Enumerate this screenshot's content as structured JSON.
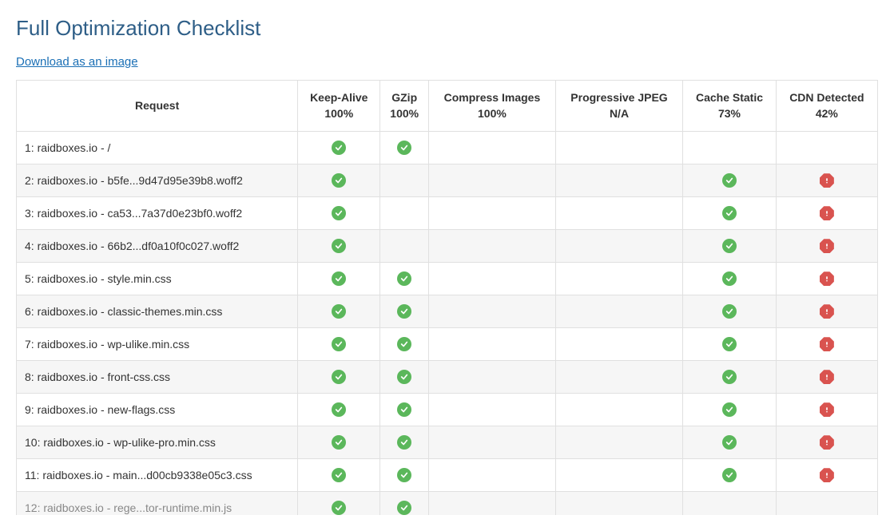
{
  "title": "Full Optimization Checklist",
  "download_link": "Download as an image",
  "columns": [
    {
      "label": "Request",
      "sub": ""
    },
    {
      "label": "Keep-Alive",
      "sub": "100%"
    },
    {
      "label": "GZip",
      "sub": "100%"
    },
    {
      "label": "Compress Images",
      "sub": "100%"
    },
    {
      "label": "Progressive JPEG",
      "sub": "N/A"
    },
    {
      "label": "Cache Static",
      "sub": "73%"
    },
    {
      "label": "CDN Detected",
      "sub": "42%"
    }
  ],
  "rows": [
    {
      "request": "1: raidboxes.io - /",
      "keep_alive": "check",
      "gzip": "check",
      "compress": "",
      "pjpeg": "",
      "cache": "",
      "cdn": ""
    },
    {
      "request": "2: raidboxes.io - b5fe...9d47d95e39b8.woff2",
      "keep_alive": "check",
      "gzip": "",
      "compress": "",
      "pjpeg": "",
      "cache": "check",
      "cdn": "warn"
    },
    {
      "request": "3: raidboxes.io - ca53...7a37d0e23bf0.woff2",
      "keep_alive": "check",
      "gzip": "",
      "compress": "",
      "pjpeg": "",
      "cache": "check",
      "cdn": "warn"
    },
    {
      "request": "4: raidboxes.io - 66b2...df0a10f0c027.woff2",
      "keep_alive": "check",
      "gzip": "",
      "compress": "",
      "pjpeg": "",
      "cache": "check",
      "cdn": "warn"
    },
    {
      "request": "5: raidboxes.io - style.min.css",
      "keep_alive": "check",
      "gzip": "check",
      "compress": "",
      "pjpeg": "",
      "cache": "check",
      "cdn": "warn"
    },
    {
      "request": "6: raidboxes.io - classic-themes.min.css",
      "keep_alive": "check",
      "gzip": "check",
      "compress": "",
      "pjpeg": "",
      "cache": "check",
      "cdn": "warn"
    },
    {
      "request": "7: raidboxes.io - wp-ulike.min.css",
      "keep_alive": "check",
      "gzip": "check",
      "compress": "",
      "pjpeg": "",
      "cache": "check",
      "cdn": "warn"
    },
    {
      "request": "8: raidboxes.io - front-css.css",
      "keep_alive": "check",
      "gzip": "check",
      "compress": "",
      "pjpeg": "",
      "cache": "check",
      "cdn": "warn"
    },
    {
      "request": "9: raidboxes.io - new-flags.css",
      "keep_alive": "check",
      "gzip": "check",
      "compress": "",
      "pjpeg": "",
      "cache": "check",
      "cdn": "warn"
    },
    {
      "request": "10: raidboxes.io - wp-ulike-pro.min.css",
      "keep_alive": "check",
      "gzip": "check",
      "compress": "",
      "pjpeg": "",
      "cache": "check",
      "cdn": "warn"
    },
    {
      "request": "11: raidboxes.io - main...d00cb9338e05c3.css",
      "keep_alive": "check",
      "gzip": "check",
      "compress": "",
      "pjpeg": "",
      "cache": "check",
      "cdn": "warn"
    }
  ],
  "partial_row": {
    "request": "12: raidboxes.io - rege...tor-runtime.min.js",
    "keep_alive": "check",
    "gzip": "check",
    "compress": "",
    "pjpeg": "",
    "cache": "",
    "cdn": ""
  }
}
